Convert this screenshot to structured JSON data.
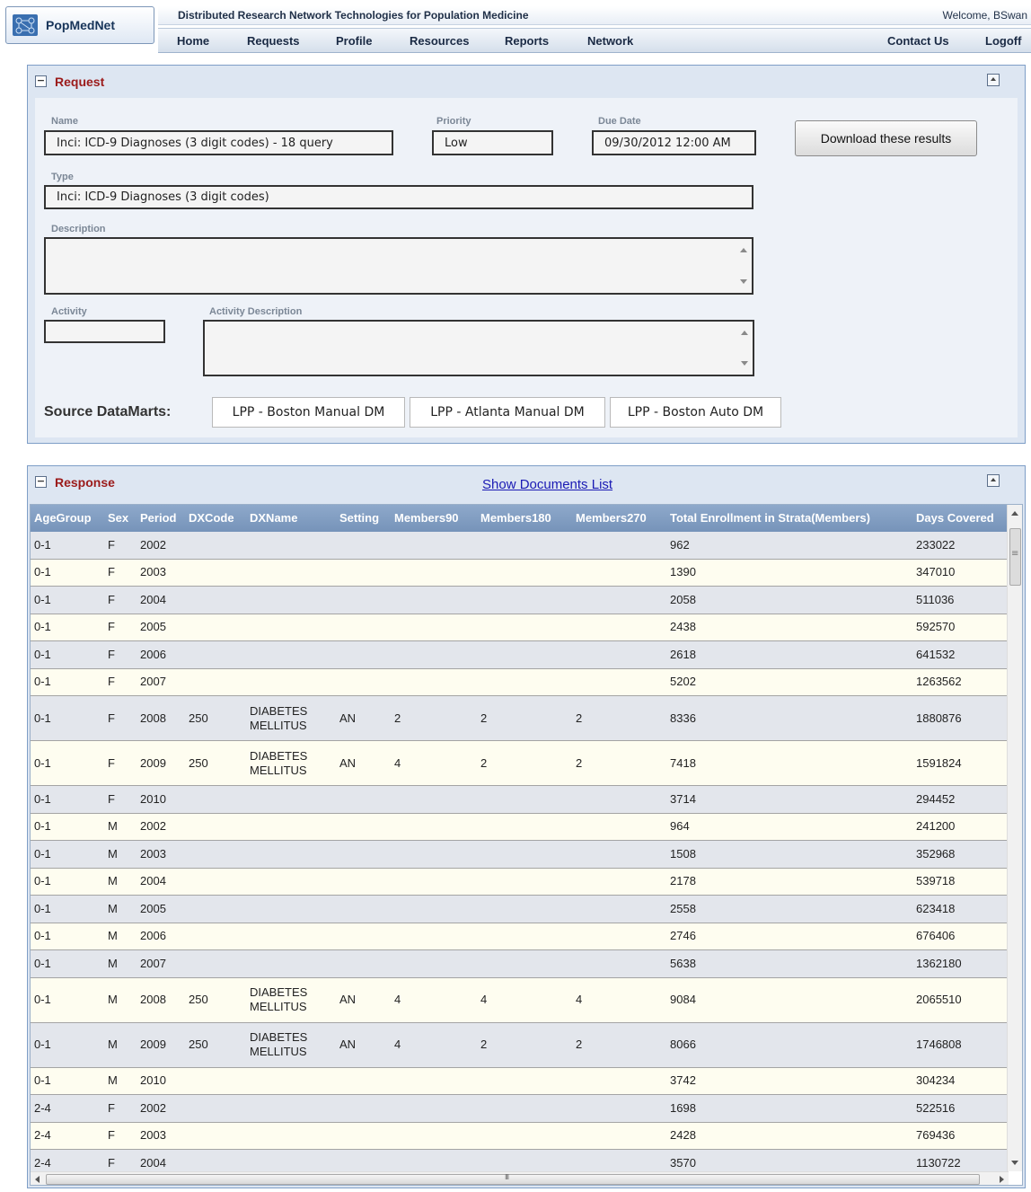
{
  "app": {
    "logo_text": "PopMedNet",
    "tagline": "Distributed Research Network Technologies for Population Medicine",
    "welcome": "Welcome, BSwan"
  },
  "nav": {
    "items": [
      "Home",
      "Requests",
      "Profile",
      "Resources",
      "Reports",
      "Network"
    ],
    "right": [
      "Contact Us",
      "Logoff"
    ]
  },
  "request": {
    "title": "Request",
    "name_label": "Name",
    "name_value": "Inci: ICD-9 Diagnoses (3 digit codes) - 18 query",
    "priority_label": "Priority",
    "priority_value": "Low",
    "due_label": "Due Date",
    "due_value": "09/30/2012 12:00 AM",
    "download_label": "Download these results",
    "type_label": "Type",
    "type_value": "Inci: ICD-9 Diagnoses (3 digit codes)",
    "description_label": "Description",
    "activity_label": "Activity",
    "activity_value": "",
    "activity_desc_label": "Activity Description",
    "source_label": "Source DataMarts:",
    "datamarts": [
      "LPP - Boston Manual DM",
      "LPP - Atlanta Manual DM",
      "LPP - Boston Auto DM"
    ]
  },
  "response": {
    "title": "Response",
    "docs_link": "Show Documents List",
    "columns": [
      "AgeGroup",
      "Sex",
      "Period",
      "DXCode",
      "DXName",
      "Setting",
      "Members90",
      "Members180",
      "Members270",
      "Total Enrollment in Strata(Members)",
      "Days Covered"
    ],
    "rows": [
      [
        "0-1",
        "F",
        "2002",
        "",
        "",
        "",
        "",
        "",
        "",
        "962",
        "233022"
      ],
      [
        "0-1",
        "F",
        "2003",
        "",
        "",
        "",
        "",
        "",
        "",
        "1390",
        "347010"
      ],
      [
        "0-1",
        "F",
        "2004",
        "",
        "",
        "",
        "",
        "",
        "",
        "2058",
        "511036"
      ],
      [
        "0-1",
        "F",
        "2005",
        "",
        "",
        "",
        "",
        "",
        "",
        "2438",
        "592570"
      ],
      [
        "0-1",
        "F",
        "2006",
        "",
        "",
        "",
        "",
        "",
        "",
        "2618",
        "641532"
      ],
      [
        "0-1",
        "F",
        "2007",
        "",
        "",
        "",
        "",
        "",
        "",
        "5202",
        "1263562"
      ],
      [
        "0-1",
        "F",
        "2008",
        "250",
        "DIABETES MELLITUS",
        "AN",
        "2",
        "2",
        "2",
        "8336",
        "1880876"
      ],
      [
        "0-1",
        "F",
        "2009",
        "250",
        "DIABETES MELLITUS",
        "AN",
        "4",
        "2",
        "2",
        "7418",
        "1591824"
      ],
      [
        "0-1",
        "F",
        "2010",
        "",
        "",
        "",
        "",
        "",
        "",
        "3714",
        "294452"
      ],
      [
        "0-1",
        "M",
        "2002",
        "",
        "",
        "",
        "",
        "",
        "",
        "964",
        "241200"
      ],
      [
        "0-1",
        "M",
        "2003",
        "",
        "",
        "",
        "",
        "",
        "",
        "1508",
        "352968"
      ],
      [
        "0-1",
        "M",
        "2004",
        "",
        "",
        "",
        "",
        "",
        "",
        "2178",
        "539718"
      ],
      [
        "0-1",
        "M",
        "2005",
        "",
        "",
        "",
        "",
        "",
        "",
        "2558",
        "623418"
      ],
      [
        "0-1",
        "M",
        "2006",
        "",
        "",
        "",
        "",
        "",
        "",
        "2746",
        "676406"
      ],
      [
        "0-1",
        "M",
        "2007",
        "",
        "",
        "",
        "",
        "",
        "",
        "5638",
        "1362180"
      ],
      [
        "0-1",
        "M",
        "2008",
        "250",
        "DIABETES MELLITUS",
        "AN",
        "4",
        "4",
        "4",
        "9084",
        "2065510"
      ],
      [
        "0-1",
        "M",
        "2009",
        "250",
        "DIABETES MELLITUS",
        "AN",
        "4",
        "2",
        "2",
        "8066",
        "1746808"
      ],
      [
        "0-1",
        "M",
        "2010",
        "",
        "",
        "",
        "",
        "",
        "",
        "3742",
        "304234"
      ],
      [
        "2-4",
        "F",
        "2002",
        "",
        "",
        "",
        "",
        "",
        "",
        "1698",
        "522516"
      ],
      [
        "2-4",
        "F",
        "2003",
        "",
        "",
        "",
        "",
        "",
        "",
        "2428",
        "769436"
      ],
      [
        "2-4",
        "F",
        "2004",
        "",
        "",
        "",
        "",
        "",
        "",
        "3570",
        "1130722"
      ]
    ]
  },
  "colors": {
    "panel_title": "#9b1a1a",
    "grid_header": "#7693b9",
    "row_odd": "#e3e6ec",
    "row_even": "#fefdf0",
    "link": "#1a1ab4"
  }
}
